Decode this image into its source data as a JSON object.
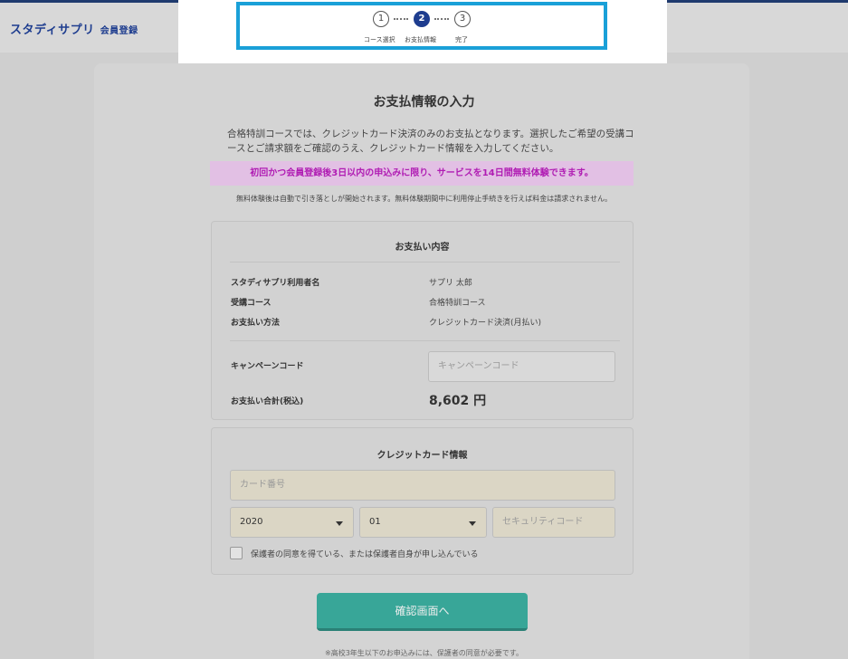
{
  "header": {
    "logo": "スタディサプリ",
    "logo_sub": "会員登録"
  },
  "stepper": {
    "steps": [
      {
        "num": "1",
        "label": "コース選択"
      },
      {
        "num": "2",
        "label": "お支払情報"
      },
      {
        "num": "3",
        "label": "完了"
      }
    ],
    "active": 2
  },
  "page": {
    "title": "お支払情報の入力",
    "intro": "合格特訓コースでは、クレジットカード決済のみのお支払となります。選択したご希望の受講コースとご請求額をご確認のうえ、クレジットカード情報を入力してください。",
    "promo": "初回かつ会員登録後3日以内の申込みに限り、サービスを14日間無料体験できます。",
    "note": "無料体験後は自動で引き落としが開始されます。無料体験期間中に利用停止手続きを行えば料金は請求されません。"
  },
  "payment": {
    "title": "お支払い内容",
    "rows": [
      {
        "label": "スタディサプリ利用者名",
        "value": "サプリ 太郎"
      },
      {
        "label": "受講コース",
        "value": "合格特訓コース"
      },
      {
        "label": "お支払い方法",
        "value": "クレジットカード決済(月払い)"
      }
    ],
    "campaign_label": "キャンペーンコード",
    "campaign_placeholder": "キャンペーンコード",
    "total_label": "お支払い合計(税込)",
    "total_value": "8,602 円"
  },
  "card": {
    "title": "クレジットカード情報",
    "number_placeholder": "カード番号",
    "year": "2020",
    "month": "01",
    "security_placeholder": "セキュリティコード",
    "consent_label": "保護者の同意を得ている、または保護者自身が申し込んでいる"
  },
  "actions": {
    "confirm_label": "確認画面へ"
  },
  "footer": {
    "note": "※高校3年生以下のお申込みには、保護者の同意が必要です。"
  },
  "colors": {
    "brand": "#1e3d8f",
    "accent": "#38a698",
    "promo_text": "#b01cb3",
    "highlight": "#1aa0d8"
  }
}
